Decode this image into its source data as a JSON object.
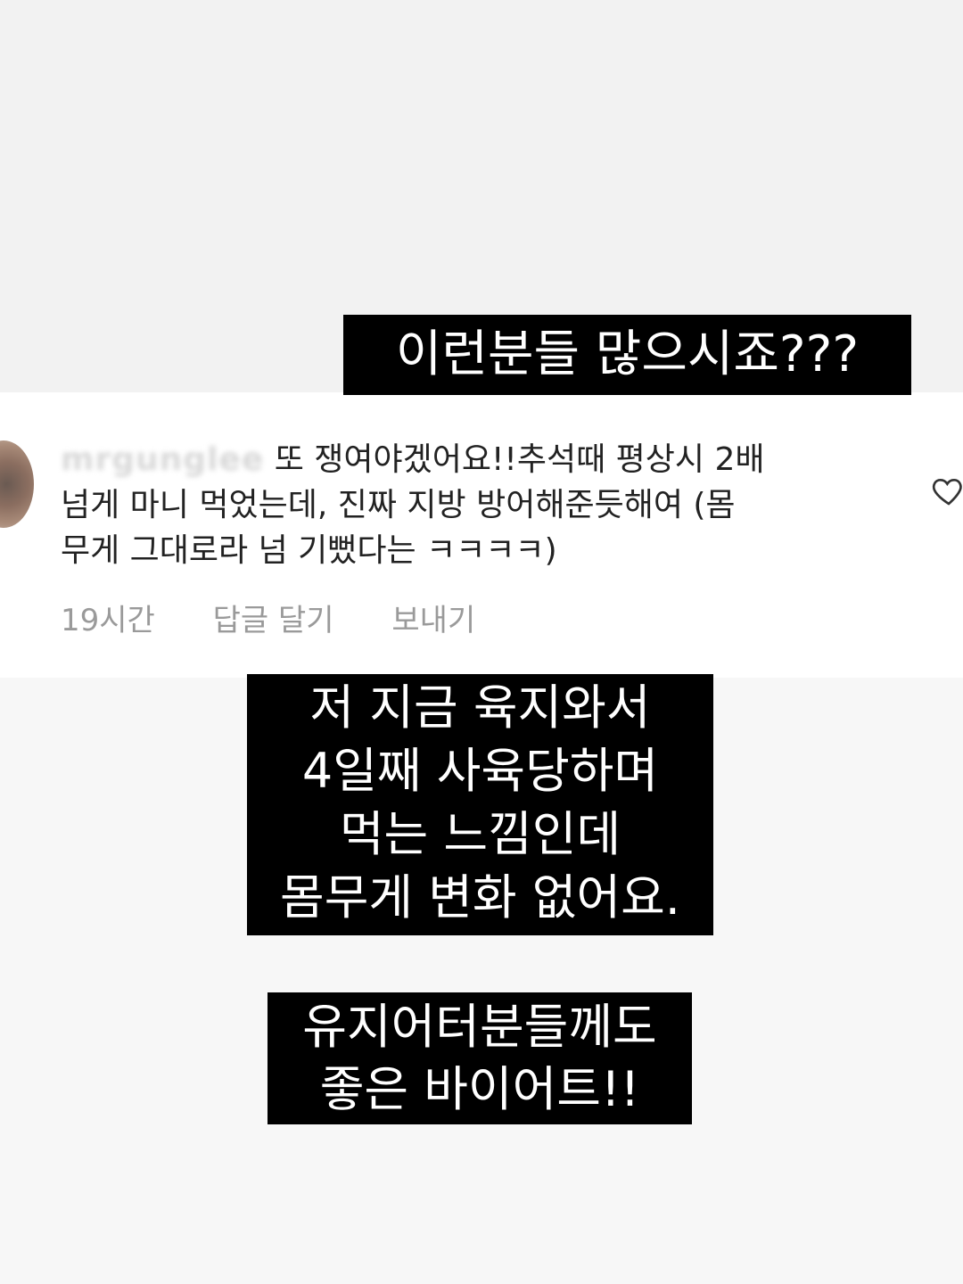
{
  "captions": {
    "top": "이런분들 많으시죠???",
    "middle": [
      "저 지금 육지와서",
      "4일째 사육당하며",
      "먹는 느낌인데",
      "몸무게 변화 없어요."
    ],
    "bottom": [
      "유지어터분들께도",
      "좋은 바이어트!!"
    ]
  },
  "comment": {
    "username": "mrgunglee",
    "lines": [
      "또 쟁여야겠어요!!추석때 평상시 2배",
      "넘게 마니 먹었는데, 진짜 지방 방어해준듯해여 (몸",
      "무게 그대로라 넘 기뻤다는 ㅋㅋㅋㅋ)"
    ],
    "time": "19시간",
    "reply_label": "답글 달기",
    "send_label": "보내기"
  },
  "icons": {
    "like": "heart-outline-icon",
    "avatar": "profile-avatar"
  },
  "colors": {
    "caption_bg": "#000000",
    "caption_text": "#ffffff",
    "meta_text": "#9a9a9a"
  }
}
